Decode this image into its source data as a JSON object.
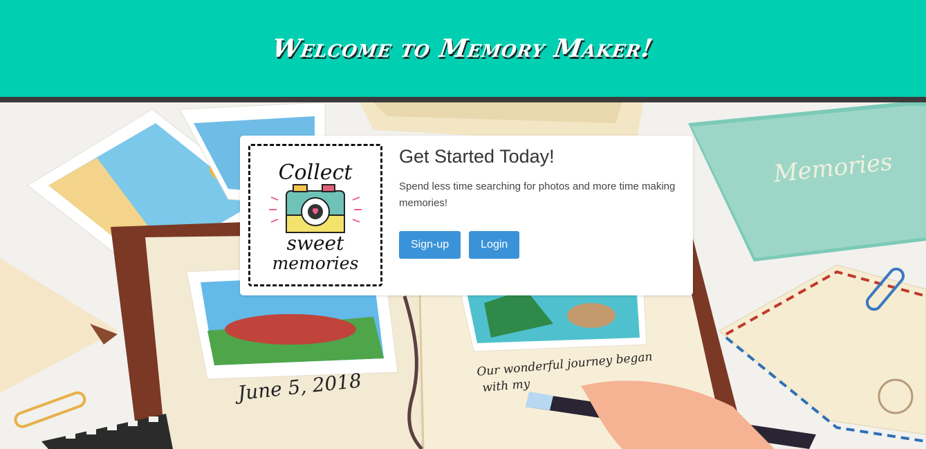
{
  "header": {
    "title": "Welcome to Memory Maker!"
  },
  "card": {
    "title": "Get Started Today!",
    "text": "Spend less time searching for photos and more time making memories!",
    "signup_label": "Sign-up",
    "login_label": "Login",
    "logo": {
      "line1": "Collect",
      "line2": "sweet",
      "line3": "memories"
    }
  },
  "hero": {
    "album_date": "June 5, 2018",
    "album_note_line1": "Our wonderful journey began",
    "album_note_line2": "with my",
    "book_title": "Memories"
  },
  "colors": {
    "header": "#00cfb2",
    "divider": "#3b3b3b",
    "button": "#3a93d9"
  }
}
